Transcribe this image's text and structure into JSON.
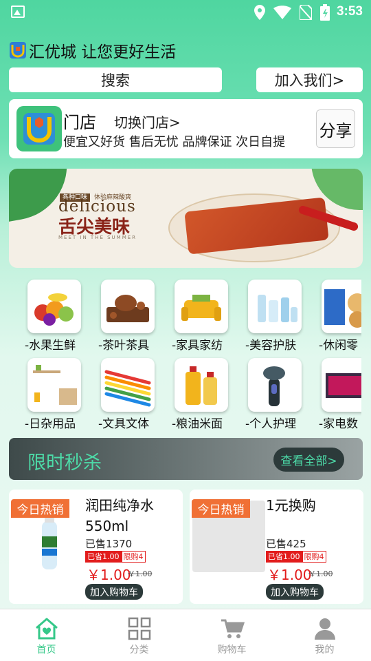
{
  "status_bar": {
    "time": "3:53"
  },
  "header": {
    "brand_text": "汇优城 让您更好生活"
  },
  "search": {
    "label": "搜索"
  },
  "join": {
    "label": "加入我们>"
  },
  "store": {
    "name": "门店",
    "switch_label": "切换门店>",
    "slogan": "便宜又好货 售后无忧 品牌保证 次日自提",
    "share_label": "分享"
  },
  "banner": {
    "tag1": "各种口味",
    "tag2": "体验麻辣酸爽",
    "title_en": "delicious",
    "title_cn": "舌尖美味",
    "sub": "MEET IN THE SUMMER"
  },
  "categories": [
    {
      "label": "-水果生鲜",
      "icon": "fruit-icon"
    },
    {
      "label": "-茶叶茶具",
      "icon": "tea-icon"
    },
    {
      "label": "-家具家纺",
      "icon": "sofa-icon"
    },
    {
      "label": "-美容护肤",
      "icon": "skincare-icon"
    },
    {
      "label": "-休闲零",
      "icon": "snack-icon"
    },
    {
      "label": "-日杂用品",
      "icon": "household-icon"
    },
    {
      "label": "-文具文体",
      "icon": "stationery-icon"
    },
    {
      "label": "-粮油米面",
      "icon": "oil-icon"
    },
    {
      "label": "-个人护理",
      "icon": "shaver-icon"
    },
    {
      "label": "-家电数",
      "icon": "tv-icon"
    }
  ],
  "flash_sale": {
    "title": "限时秒杀",
    "more_label": "查看全部>"
  },
  "products": [
    {
      "hot_tag": "今日热销",
      "name": "润田纯净水550ml",
      "sold": "已售1370",
      "save_tag": "已省1.00",
      "limit_tag": "限购4",
      "price": "￥1.00",
      "original_price": "￥1.00",
      "cart_label": "加入购物车"
    },
    {
      "hot_tag": "今日热销",
      "name": "1元换购",
      "sold": "已售425",
      "save_tag": "已省1.00",
      "limit_tag": "限购4",
      "price": "￥1.00",
      "original_price": "￥1.00",
      "cart_label": "加入购物车"
    }
  ],
  "tabs": [
    {
      "label": "首页",
      "icon": "home-icon",
      "active": true
    },
    {
      "label": "分类",
      "icon": "grid-icon",
      "active": false
    },
    {
      "label": "购物车",
      "icon": "cart-icon",
      "active": false
    },
    {
      "label": "我的",
      "icon": "user-icon",
      "active": false
    }
  ],
  "colors": {
    "accent": "#35c889",
    "price": "#e21c1c",
    "hot_tag": "#f07035"
  }
}
